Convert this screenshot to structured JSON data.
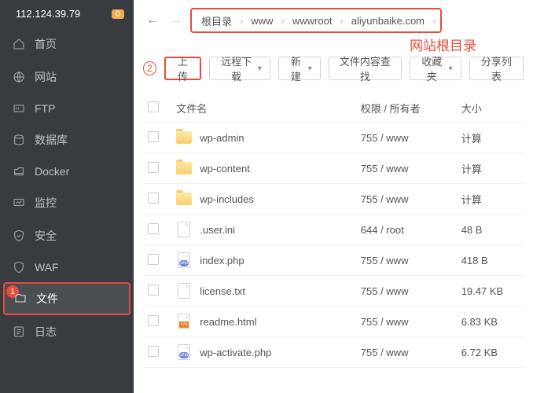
{
  "header": {
    "ip": "112.124.39.79",
    "badge": "0"
  },
  "sidebar": {
    "items": [
      {
        "label": "首页"
      },
      {
        "label": "网站"
      },
      {
        "label": "FTP"
      },
      {
        "label": "数据库"
      },
      {
        "label": "Docker"
      },
      {
        "label": "监控"
      },
      {
        "label": "安全"
      },
      {
        "label": "WAF"
      },
      {
        "label": "文件"
      },
      {
        "label": "日志"
      }
    ]
  },
  "breadcrumb": [
    "根目录",
    "www",
    "wwwroot",
    "aliyunbaike.com"
  ],
  "annotations": {
    "step1": "1",
    "step2": "2",
    "root_label": "网站根目录"
  },
  "toolbar": {
    "upload": "上传",
    "remote_download": "远程下载",
    "new": "新建",
    "content_search": "文件内容查找",
    "favorites": "收藏夹",
    "share_list": "分享列表"
  },
  "table": {
    "headers": {
      "name": "文件名",
      "perm": "权限 / 所有者",
      "size": "大小"
    },
    "rows": [
      {
        "type": "folder",
        "name": "wp-admin",
        "perm": "755 / www",
        "size": "计算",
        "calc": true
      },
      {
        "type": "folder",
        "name": "wp-content",
        "perm": "755 / www",
        "size": "计算",
        "calc": true
      },
      {
        "type": "folder",
        "name": "wp-includes",
        "perm": "755 / www",
        "size": "计算",
        "calc": true
      },
      {
        "type": "doc",
        "name": ".user.ini",
        "perm": "644 / root",
        "size": "48 B"
      },
      {
        "type": "php",
        "name": "index.php",
        "perm": "755 / www",
        "size": "418 B"
      },
      {
        "type": "doc",
        "name": "license.txt",
        "perm": "755 / www",
        "size": "19.47 KB"
      },
      {
        "type": "html",
        "name": "readme.html",
        "perm": "755 / www",
        "size": "6.83 KB"
      },
      {
        "type": "php",
        "name": "wp-activate.php",
        "perm": "755 / www",
        "size": "6.72 KB"
      }
    ]
  }
}
